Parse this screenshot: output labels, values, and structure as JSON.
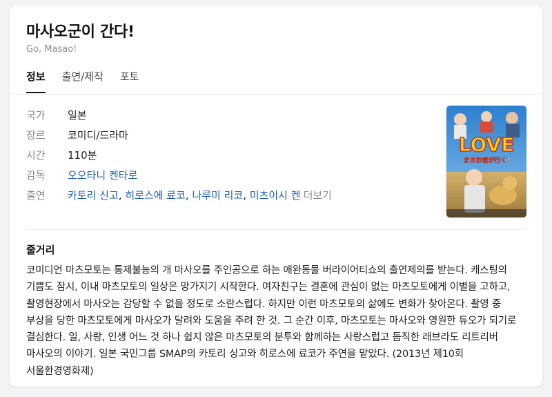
{
  "title": "마사오군이 간다!",
  "subtitle": "Go, Masao!",
  "tabs": [
    {
      "label": "정보",
      "active": true
    },
    {
      "label": "출연/제작",
      "active": false
    },
    {
      "label": "포토",
      "active": false
    }
  ],
  "info": {
    "country": {
      "label": "국가",
      "value": "일본"
    },
    "genre": {
      "label": "장르",
      "value": "코미디/드라마"
    },
    "runtime": {
      "label": "시간",
      "value": "110분"
    },
    "director": {
      "label": "감독",
      "value": "오오타니 켄타로"
    },
    "cast": {
      "label": "출연",
      "names": [
        "카토리 신고",
        "히로스에 료코",
        "나루미 리코",
        "미츠이시 켄"
      ],
      "more": "더보기"
    }
  },
  "poster": {
    "title_text": "LOVE",
    "subtitle_text": "まさお君が行く!",
    "colors": {
      "sky": "#3a8fd6",
      "ground": "#c7a25d",
      "title": "#f7d21b"
    }
  },
  "plot": {
    "heading": "줄거리",
    "text": "코미디언 마츠모토는 통제불능의 개 마사오를 주인공으로 하는 애완동물 버라이어티쇼의 출연제의를 받는다. 캐스팅의 기쁨도 잠시, 이내 마츠모토의 일상은 망가지기 시작한다. 여자친구는 결혼에 관심이 없는 마츠모토에게 이별을 고하고, 촬영현장에서 마사오는 감당할 수 없을 정도로 소란스럽다. 하지만 이런 마츠모토의 삶에도 변화가 찾아온다. 촬영 중 부상을 당한 마츠모토에게 마사오가 달려와 도움을 주려 한 것. 그 순간 이후, 마츠모토는 마사오와 영원한 듀오가 되기로 결심한다. 일, 사랑, 인생 어느 것 하나 쉽지 않은 마츠모토의 분투와 함께하는 사랑스럽고 듬직한 래브라도 리트리버 마사오의 이야기. 일본 국민그룹 SMAP의 카토리 싱고와 히로스에 료코가 주연을 맡았다. (2013년 제10회 서울환경영화제)"
  }
}
